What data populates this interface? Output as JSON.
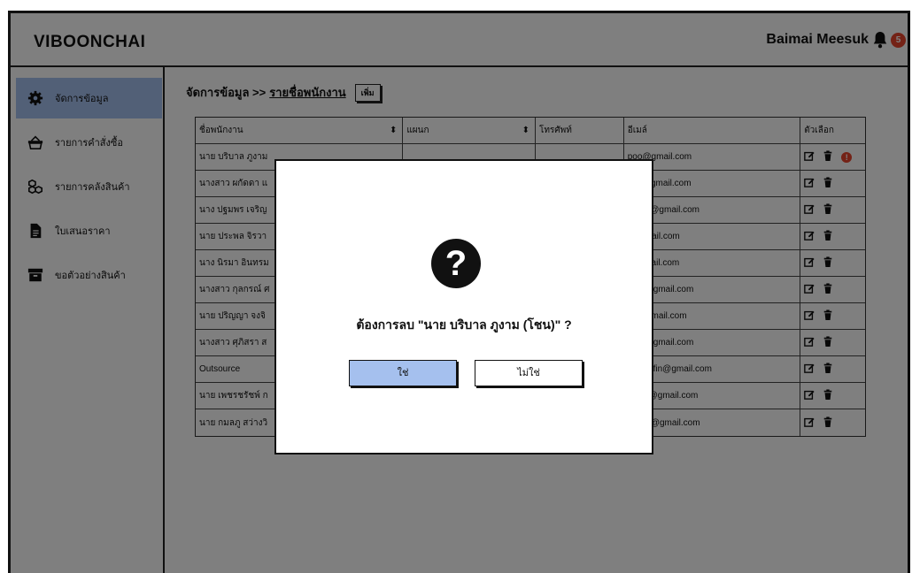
{
  "header": {
    "brand": "VIBOONCHAI",
    "user": "Baimai Meesuk",
    "notif_count": "5"
  },
  "sidebar": {
    "items": [
      {
        "label": "จัดการข้อมูล",
        "icon": "gear-icon"
      },
      {
        "label": "รายการคำสั่งซื้อ",
        "icon": "basket-icon"
      },
      {
        "label": "รายการคลังสินค้า",
        "icon": "boxes-icon"
      },
      {
        "label": "ใบเสนอราคา",
        "icon": "document-icon"
      },
      {
        "label": "ขอตัวอย่างสินค้า",
        "icon": "archive-icon"
      }
    ]
  },
  "breadcrumb": {
    "root": "จัดการข้อมูล >>",
    "current": "รายชื่อพนักงาน",
    "add_label": "เพิ่ม"
  },
  "table": {
    "headers": [
      "ชื่อพนักงาน",
      "แผนก",
      "โทรศัพท์",
      "อีเมล์",
      "ตัวเลือก"
    ],
    "rows": [
      {
        "name": "นาย บริบาล ภูงาม",
        "email": "poo@gmail.com"
      },
      {
        "name": "นางสาว ผกัดดา แ",
        "email": "son@gmail.com"
      },
      {
        "name": "นาง ปฐมพร เจริญ",
        "email": "ornjar@gmail.com"
      },
      {
        "name": "นาย ประพล จิรวา",
        "email": "r@gmail.com"
      },
      {
        "name": "นาง นิรมา อินทรม",
        "email": "t@gmail.com"
      },
      {
        "name": "นางสาว กุลกรณ์ ศ",
        "email": "n.sir@gmail.com"
      },
      {
        "name": "นาย ปริญญา จงจิ",
        "email": "on@gmail.com"
      },
      {
        "name": "นางสาว ศุภิสรา ส",
        "email": "i.sor@gmail.com"
      },
      {
        "name": "Outsource",
        "email": "ce.occfin@gmail.com"
      },
      {
        "name": "นาย เพชรชรัชพ์ ก",
        "email": "ot.kin@gmail.com"
      },
      {
        "name": "นาย กมลภู สว่างวิ",
        "email": "o.saw@gmail.com"
      }
    ]
  },
  "modal": {
    "icon": "?",
    "message": "ต้องการลบ \"นาย บริบาล ภูงาม (โชน)\" ?",
    "yes_label": "ใช่",
    "no_label": "ไม่ใช่"
  },
  "colors": {
    "accent": "#a5c0ee",
    "alert": "#e8452c"
  }
}
